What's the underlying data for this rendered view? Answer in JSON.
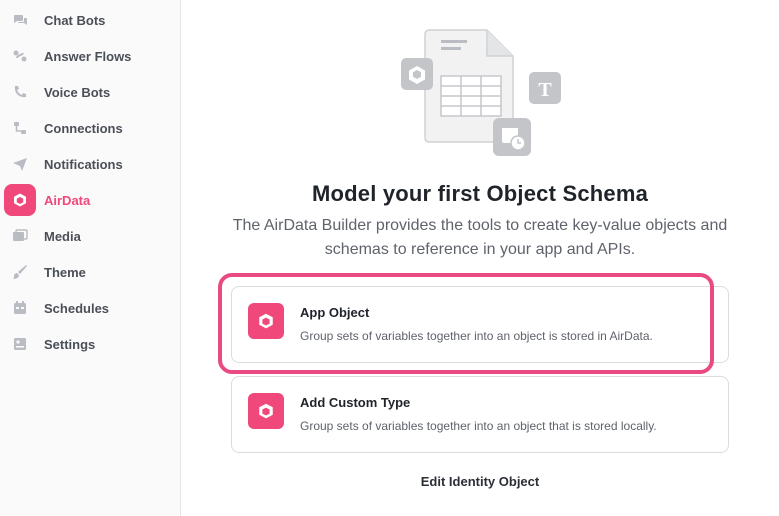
{
  "sidebar": {
    "items": [
      {
        "label": "Chat Bots",
        "icon": "chat-bubbles-icon",
        "active": false
      },
      {
        "label": "Answer Flows",
        "icon": "answer-flows-icon",
        "active": false
      },
      {
        "label": "Voice Bots",
        "icon": "phone-icon",
        "active": false
      },
      {
        "label": "Connections",
        "icon": "connections-icon",
        "active": false
      },
      {
        "label": "Notifications",
        "icon": "paper-plane-icon",
        "active": false
      },
      {
        "label": "AirData",
        "icon": "cube-icon",
        "active": true
      },
      {
        "label": "Media",
        "icon": "images-icon",
        "active": false
      },
      {
        "label": "Theme",
        "icon": "brush-icon",
        "active": false
      },
      {
        "label": "Schedules",
        "icon": "calendar-icon",
        "active": false
      },
      {
        "label": "Settings",
        "icon": "settings-panel-icon",
        "active": false
      }
    ]
  },
  "main": {
    "title": "Model your first Object Schema",
    "subtitle": "The AirData Builder provides the tools to create key-value objects and schemas to reference in your app and APIs.",
    "cards": [
      {
        "title": "App Object",
        "description": "Group sets of variables together into an object is stored in AirData.",
        "icon": "cube-icon",
        "highlighted": true
      },
      {
        "title": "Add Custom Type",
        "description": "Group sets of variables together into an object that is stored locally.",
        "icon": "cube-icon",
        "highlighted": false
      }
    ],
    "edit_link": "Edit Identity Object"
  },
  "colors": {
    "accent": "#f0487a",
    "highlight_border": "#ea4a82",
    "sidebar_bg": "#fafafa",
    "icon_gray": "#b9bcc2"
  }
}
